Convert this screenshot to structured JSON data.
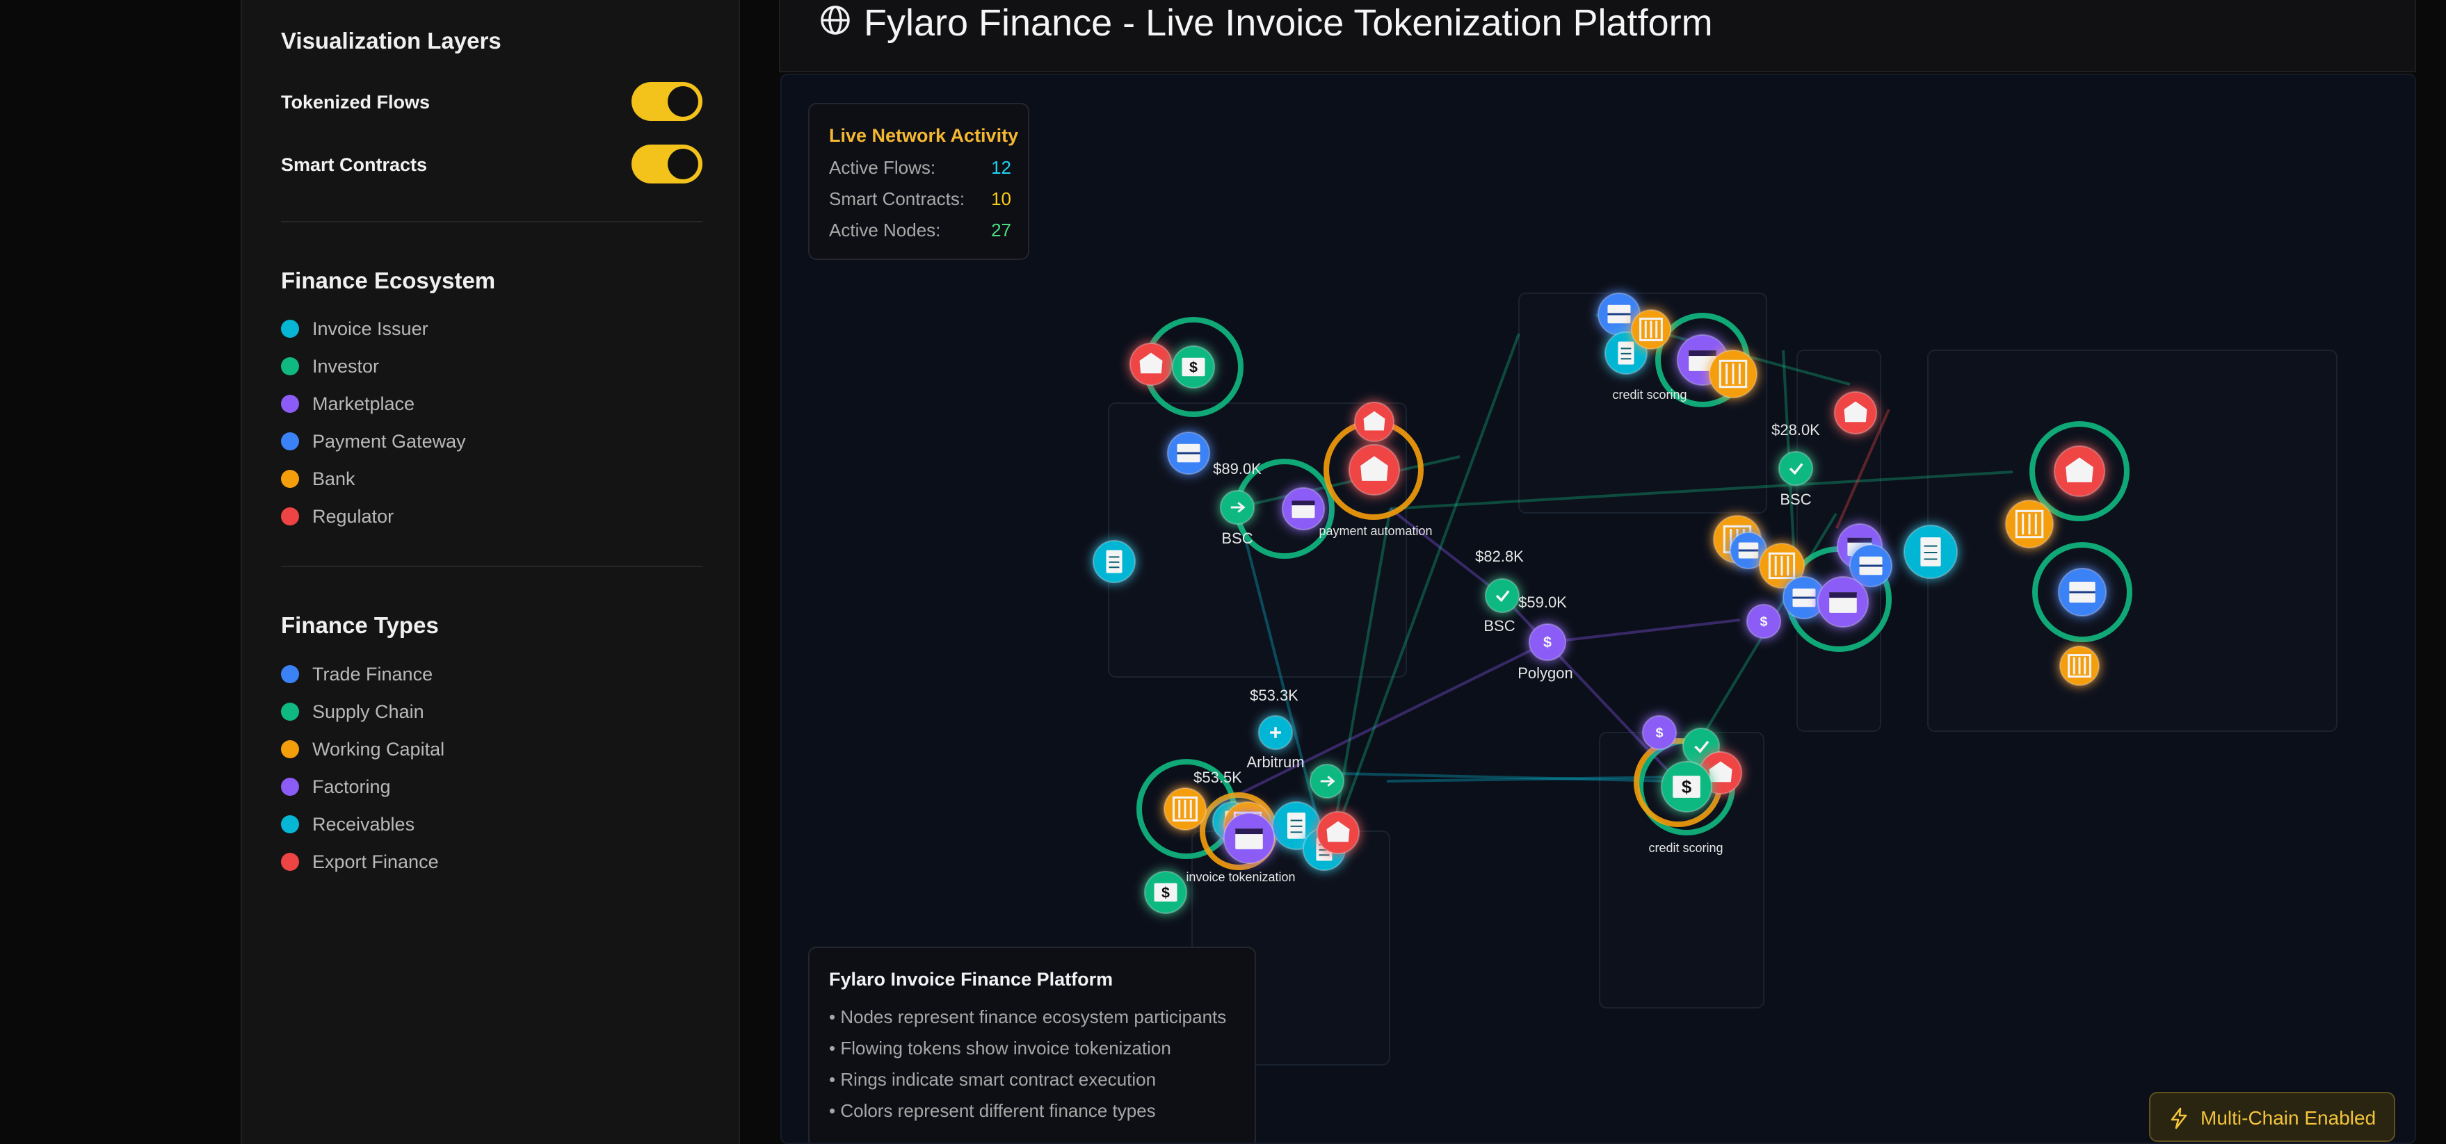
{
  "sidebar": {
    "layers_heading": "Visualization Layers",
    "toggles": [
      {
        "label": "Tokenized Flows",
        "on": true
      },
      {
        "label": "Smart Contracts",
        "on": true
      }
    ],
    "ecosystem_heading": "Finance Ecosystem",
    "ecosystem": [
      {
        "label": "Invoice Issuer",
        "color": "#06b6d4"
      },
      {
        "label": "Investor",
        "color": "#10b981"
      },
      {
        "label": "Marketplace",
        "color": "#8b5cf6"
      },
      {
        "label": "Payment Gateway",
        "color": "#3b82f6"
      },
      {
        "label": "Bank",
        "color": "#f59e0b"
      },
      {
        "label": "Regulator",
        "color": "#ef4444"
      }
    ],
    "types_heading": "Finance Types",
    "types": [
      {
        "label": "Trade Finance",
        "color": "#3b82f6"
      },
      {
        "label": "Supply Chain",
        "color": "#10b981"
      },
      {
        "label": "Working Capital",
        "color": "#f59e0b"
      },
      {
        "label": "Factoring",
        "color": "#8b5cf6"
      },
      {
        "label": "Receivables",
        "color": "#06b6d4"
      },
      {
        "label": "Export Finance",
        "color": "#ef4444"
      }
    ]
  },
  "header": {
    "title": "Fylaro Finance - Live Invoice Tokenization Platform",
    "icon": "globe-icon"
  },
  "stats": {
    "heading": "Live Network Activity",
    "rows": [
      {
        "label": "Active Flows:",
        "value": "12",
        "color": "#22d3ee"
      },
      {
        "label": "Smart Contracts:",
        "value": "10",
        "color": "#facc15"
      },
      {
        "label": "Active Nodes:",
        "value": "27",
        "color": "#4ade80"
      }
    ]
  },
  "info": {
    "heading": "Fylaro Invoice Finance Platform",
    "lines": [
      "• Nodes represent finance ecosystem participants",
      "• Flowing tokens show invoice tokenization",
      "• Rings indicate smart contract execution",
      "• Colors represent different finance types"
    ]
  },
  "badge": {
    "label": "Multi-Chain Enabled",
    "icon": "lightning-icon"
  },
  "network": {
    "value_labels": [
      "$89.0K",
      "$82.8K",
      "$59.0K",
      "$53.3K",
      "$53.5K",
      "$28.0K"
    ],
    "chain_labels": [
      "BSC",
      "BSC",
      "Polygon",
      "Arbitrum",
      "BSC"
    ],
    "contract_labels": [
      "payment automation",
      "credit scoring",
      "credit scoring",
      "invoice tokenization"
    ],
    "colors": {
      "issuer": "#06b6d4",
      "investor": "#10b981",
      "marketplace": "#8b5cf6",
      "gateway": "#3b82f6",
      "bank": "#f59e0b",
      "regulator": "#ef4444"
    }
  }
}
